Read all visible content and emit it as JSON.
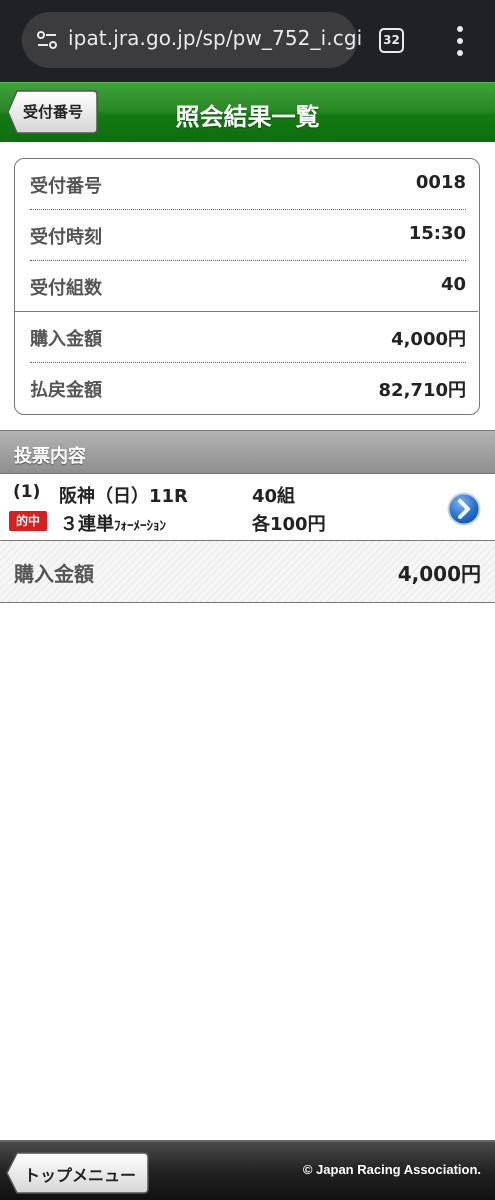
{
  "browser": {
    "url": "ipat.jra.go.jp/sp/pw_752_i.cgi",
    "tab_count": "32"
  },
  "header": {
    "back_label": "受付番号",
    "title": "照会結果一覧"
  },
  "summary": {
    "rows": [
      {
        "label": "受付番号",
        "value": "0018"
      },
      {
        "label": "受付時刻",
        "value": "15:30"
      },
      {
        "label": "受付組数",
        "value": "40"
      },
      {
        "label": "購入金額",
        "value": "4,000円"
      },
      {
        "label": "払戻金額",
        "value": "82,710円"
      }
    ]
  },
  "section": {
    "title": "投票内容"
  },
  "bet": {
    "number": "(1)",
    "race": "阪神（日）11R",
    "combinations": "40組",
    "hit_badge": "的中",
    "type_main": "３連単",
    "type_sub": "ﾌｫｰﾒｰｼｮﾝ",
    "amount_each": "各100円"
  },
  "total": {
    "label": "購入金額",
    "value": "4,000円"
  },
  "footer": {
    "top_menu_label": "トップメニュー",
    "copyright": "© Japan Racing Association."
  },
  "colors": {
    "header_green": "#2a8a26",
    "hit_red": "#e01b1b",
    "arrow_blue": "#1f6fd1"
  }
}
